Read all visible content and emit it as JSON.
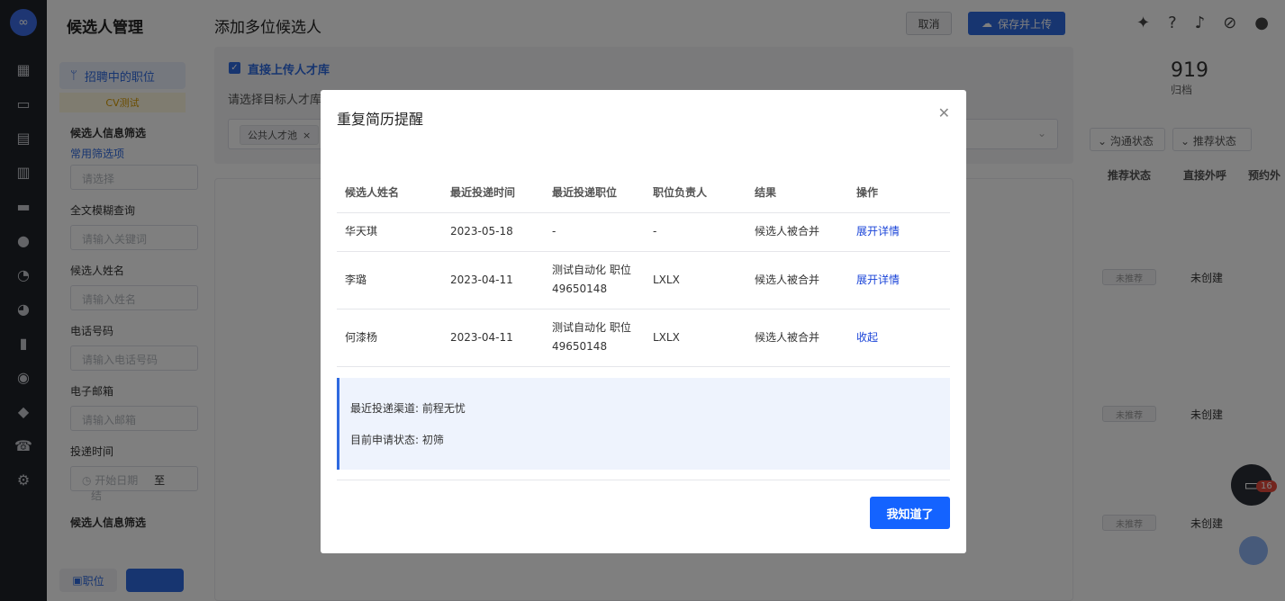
{
  "sidebar": {
    "icons": [
      "dashboard-icon",
      "briefcase-icon",
      "resume-icon",
      "calendar-icon",
      "id-card-icon",
      "wechat-icon",
      "analytics-icon",
      "pie-chart-icon",
      "bar-chart-icon",
      "person-circle-icon",
      "people-icon",
      "phone-icon",
      "settings-icon"
    ]
  },
  "filter_panel": {
    "title": "候选人管理",
    "job_selector": "招聘中的职位",
    "cv_tag": "CV测试",
    "section_info": "候选人信息筛选",
    "common_filters": "常用筛选项",
    "common_placeholder": "请选择",
    "fulltext_label": "全文模糊查询",
    "fulltext_placeholder": "请输入关键词",
    "name_label": "候选人姓名",
    "name_placeholder": "请输入姓名",
    "phone_label": "电话号码",
    "phone_placeholder": "请输入电话号码",
    "email_label": "电子邮箱",
    "email_placeholder": "请输入邮箱",
    "date_label": "投递时间",
    "date_start": "开始日期",
    "date_sep": "至",
    "date_end": "结",
    "section_info2": "候选人信息筛选",
    "bottom_tab_job": "职位"
  },
  "background_right": {
    "stat_num": "919",
    "stat_label": "归档",
    "dropdown_1": "沟通状态",
    "dropdown_2": "推荐状态",
    "col_recommend": "推荐状态",
    "col_call": "直接外呼",
    "col_appoint": "预约外",
    "row_tag": "未推荐",
    "row_status": "未创建",
    "chat_badge": "16"
  },
  "drawer": {
    "title": "添加多位候选人",
    "cancel": "取消",
    "save_upload": "保存并上传",
    "direct_upload": "直接上传人才库",
    "select_pool_label": "请选择目标人才库",
    "pool_tag": "公共人才池"
  },
  "modal": {
    "title": "重复简历提醒",
    "columns": [
      "候选人姓名",
      "最近投递时间",
      "最近投递职位",
      "职位负责人",
      "结果",
      "操作"
    ],
    "rows": [
      {
        "name": "华天琪",
        "time": "2023-05-18",
        "position": "-",
        "owner": "-",
        "result": "候选人被合并",
        "action": "展开详情"
      },
      {
        "name": "李璐",
        "time": "2023-04-11",
        "position": "测试自动化 职位49650148",
        "owner": "LXLX",
        "result": "候选人被合并",
        "action": "展开详情"
      },
      {
        "name": "何漆杨",
        "time": "2023-04-11",
        "position": "测试自动化 职位49650148",
        "owner": "LXLX",
        "result": "候选人被合并",
        "action": "收起"
      }
    ],
    "detail_channel": "最近投递渠道: 前程无忧",
    "detail_status": "目前申请状态: 初筛",
    "ok_button": "我知道了"
  }
}
